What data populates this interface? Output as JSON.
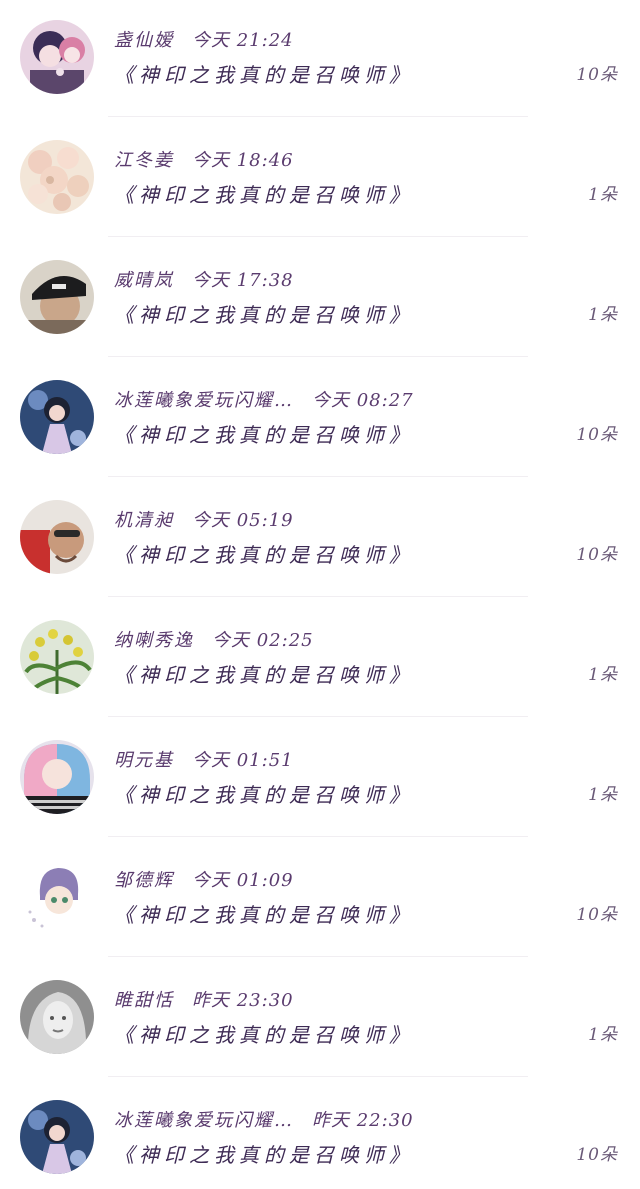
{
  "list": {
    "rows": [
      {
        "name": "盏仙嫒",
        "time": "今天 21:24",
        "title": "《神印之我真的是召唤师》",
        "amount": "10朵"
      },
      {
        "name": "江冬姜",
        "time": "今天 18:46",
        "title": "《神印之我真的是召唤师》",
        "amount": "1朵"
      },
      {
        "name": "威晴岚",
        "time": "今天 17:38",
        "title": "《神印之我真的是召唤师》",
        "amount": "1朵"
      },
      {
        "name": "冰莲曦象爱玩闪耀…",
        "time": "今天 08:27",
        "title": "《神印之我真的是召唤师》",
        "amount": "10朵"
      },
      {
        "name": "机清昶",
        "time": "今天 05:19",
        "title": "《神印之我真的是召唤师》",
        "amount": "10朵"
      },
      {
        "name": "纳喇秀逸",
        "time": "今天 02:25",
        "title": "《神印之我真的是召唤师》",
        "amount": "1朵"
      },
      {
        "name": "明元基",
        "time": "今天 01:51",
        "title": "《神印之我真的是召唤师》",
        "amount": "1朵"
      },
      {
        "name": "邹德辉",
        "time": "今天 01:09",
        "title": "《神印之我真的是召唤师》",
        "amount": "10朵"
      },
      {
        "name": "睢甜恬",
        "time": "昨天 23:30",
        "title": "《神印之我真的是召唤师》",
        "amount": "1朵"
      },
      {
        "name": "冰莲曦象爱玩闪耀…",
        "time": "昨天 22:30",
        "title": "《神印之我真的是召唤师》",
        "amount": "10朵"
      }
    ]
  }
}
